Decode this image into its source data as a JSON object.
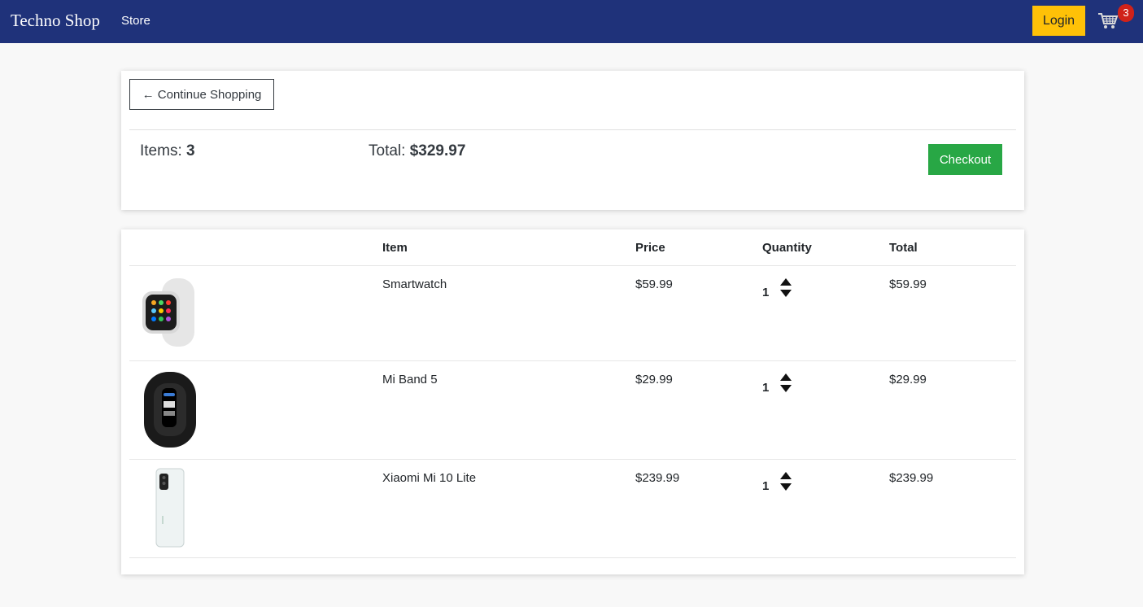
{
  "navbar": {
    "brand": "Techno Shop",
    "store_link": "Store",
    "login_label": "Login",
    "cart_icon": "cart-icon",
    "cart_count": "3"
  },
  "summary": {
    "continue_label": "← Continue Shopping",
    "items_label": "Items:",
    "items_value": "3",
    "total_label": "Total:",
    "total_value": "$329.97",
    "checkout_label": "Checkout"
  },
  "table": {
    "headers": [
      "",
      "Item",
      "Price",
      "Quantity",
      "Total"
    ],
    "rows": [
      {
        "image": "smartwatch-image",
        "item": "Smartwatch",
        "price": "$59.99",
        "quantity": "1",
        "total": "$59.99"
      },
      {
        "image": "mi-band-image",
        "item": "Mi Band 5",
        "price": "$29.99",
        "quantity": "1",
        "total": "$29.99"
      },
      {
        "image": "phone-image",
        "item": "Xiaomi Mi 10 Lite",
        "price": "$239.99",
        "quantity": "1",
        "total": "$239.99"
      }
    ]
  },
  "colors": {
    "navbar": "#1f327a",
    "login": "#ffc107",
    "checkout": "#28a745",
    "badge": "#d0221a"
  }
}
